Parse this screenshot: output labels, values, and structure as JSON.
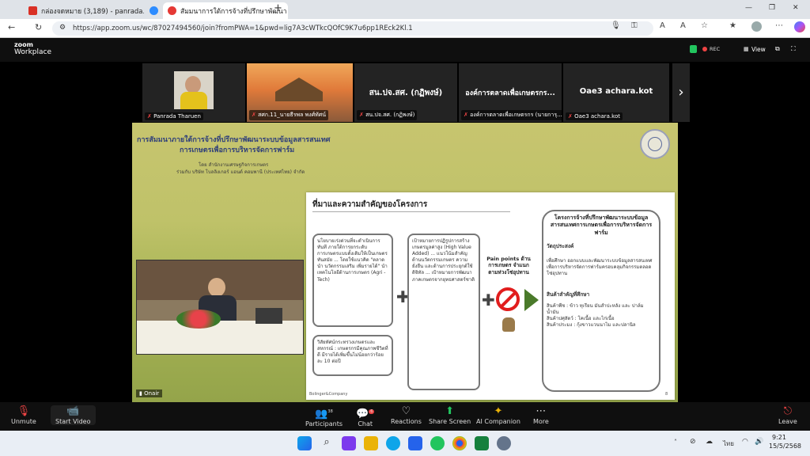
{
  "browser": {
    "tabs": [
      {
        "label": "กล่องจดหมาย (3,189) - panrada.tha",
        "color": "#d93025"
      },
      {
        "label": "",
        "color": "#2d8cff"
      },
      {
        "label": "สัมมนาการใต้การจ้างที่ปรึกษาพัฒนา",
        "color": "#e53935"
      }
    ],
    "url": "https://app.zoom.us/wc/87027494560/join?fromPWA=1&pwd=lig7A3cWTkcQOfC9K7u6pp1REck2Kl.1",
    "new_tab": "+",
    "window_controls": [
      "—",
      "❐",
      "✕"
    ]
  },
  "zoom": {
    "logo_top": "zoom",
    "logo_bottom": "Workplace",
    "rec": "REC",
    "view": "View",
    "participants_thumbs": [
      {
        "name": "Panrada Tharuen",
        "big": ""
      },
      {
        "name": "สศก.11_นายธีรพล พงศ์ทัศน์",
        "big": ""
      },
      {
        "name": "สน.ปจ.สศ. (กฏิพงษ์)",
        "big": "สน.ปจ.สศ. (กฏิพงษ์)"
      },
      {
        "name": "องค์การตลาดเพื่อเกษตรกร (นายการุ...",
        "big": "องค์การตลาดเพื่อเกษตรกร..."
      },
      {
        "name": "Oae3 achara.kot",
        "big": "Oae3 achara.kot"
      }
    ],
    "next_arrow": "›",
    "onair": "Onair",
    "controls": [
      {
        "label": "Unmute",
        "icon": "🎙"
      },
      {
        "label": "Start Video",
        "icon": "📹"
      },
      {
        "label": "Participants",
        "icon": "👥",
        "badge": "38"
      },
      {
        "label": "Chat",
        "icon": "💬",
        "badge": "6"
      },
      {
        "label": "Reactions",
        "icon": "♡"
      },
      {
        "label": "Share Screen",
        "icon": "⬆"
      },
      {
        "label": "AI Companion",
        "icon": "✦"
      },
      {
        "label": "More",
        "icon": "⋯"
      },
      {
        "label": "Leave",
        "icon": "⎋"
      }
    ]
  },
  "slide": {
    "title1": "การสัมมนาภายใต้การจ้างที่ปรึกษาพัฒนาระบบข้อมูลสารสนเทศ",
    "title2": "การเกษตรเพื่อการบริหารจัดการฟาร์ม",
    "by": "โดย สำนักงานเศรษฐกิจการเกษตร",
    "with": "ร่วมกับ บริษัท โบลลิงเกอร์ แอนด์ คอมพานี (ประเทศไทย) จำกัด",
    "card_heading": "ที่มาและความสำคัญของโครงการ",
    "box1": "นโยบายเร่งด่วนที่จะดำเนินการทันที ภายใต้การยกระดับการเกษตรแบบดั้งเดิมให้เป็นเกษตรทันสมัย ... โดยใช้แนวคิด \"ตลาดนำ นวัตกรรมเสริม เพิ่มรายได้\" นำเทคโนโลยีด้านการเกษตร (Agri - Tech)",
    "box2": "วิสัยทัศน์กระทรวงเกษตรและสหกรณ์ : เกษตรกรมีคุณภาพชีวิตที่ดี มีรายได้เพิ่มขึ้นไม่น้อยกว่าร้อยละ 10 ต่อปี",
    "box3": "เป้าหมายการปฏิรูปการสร้างเกษตรมูลค่าสูง (High Value Added) ... แนวโน้มสำคัญด้านนวัตกรรมเกษตร ความยั่งยืน และด้านการประยุกต์ใช้ดิจิทัล ... เป้าหมายการพัฒนาภาคเกษตรจากยุทธศาสตร์ชาติ",
    "pain": "Pain points ด้านการเกษตร จำแนกตามห่วงโซ่อุปทาน",
    "right_title": "โครงการจ้างที่ปรึกษาพัฒนาระบบข้อมูลสารสนเทศการเกษตรเพื่อการบริหารจัดการฟาร์ม",
    "objective_h": "วัตถุประสงค์",
    "objective": "เพื่อศึกษา ออกแบบและพัฒนาระบบข้อมูลสารสนเทศเพื่อการบริหารจัดการฟาร์มครอบคลุมกิจกรรมตลอดโซ่อุปทาน",
    "goods_h": "สินค้าสำคัญที่ศึกษา",
    "g1": "สินค้าพืช : ข้าว ทุเรียน มันสำปะหลัง และ ปาล์มน้ำมัน",
    "g2": "สินค้าปศุสัตว์ : โคเนื้อ และไก่เนื้อ",
    "g3": "สินค้าประมง : กุ้งขาวแวนนาไม และปลานิล",
    "footer": "Bolinger&Company",
    "page": "8"
  },
  "taskbar": {
    "time": "9:21",
    "date": "15/5/2568",
    "lang": "ไทย"
  }
}
